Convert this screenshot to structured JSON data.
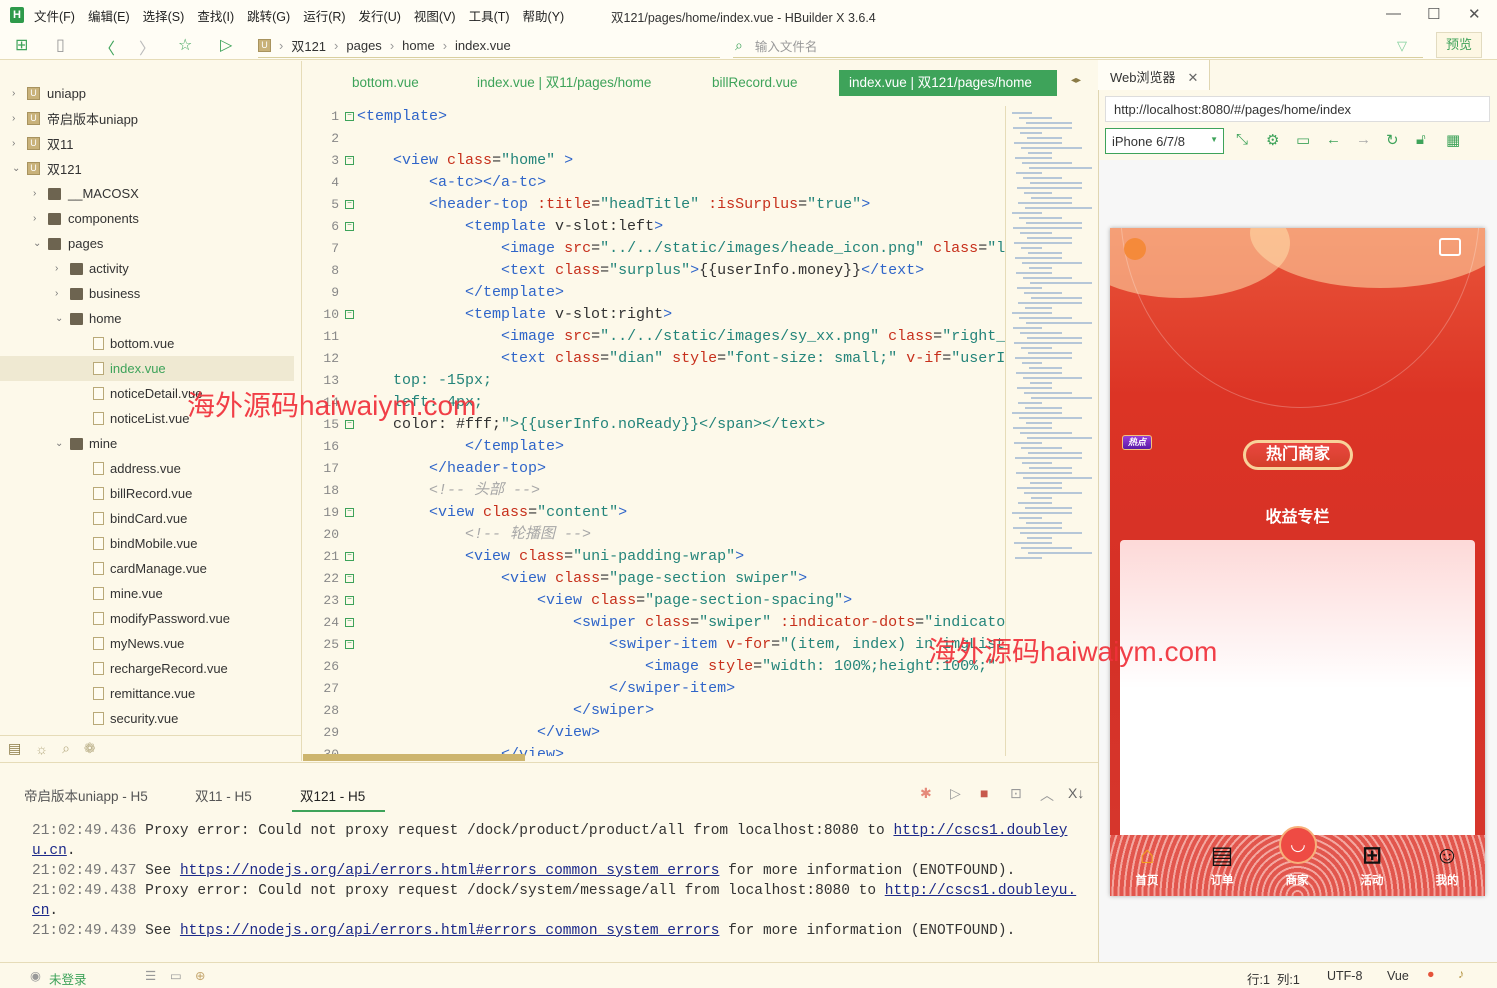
{
  "titlebar": {
    "menus": [
      "文件(F)",
      "编辑(E)",
      "选择(S)",
      "查找(I)",
      "跳转(G)",
      "运行(R)",
      "发行(U)",
      "视图(V)",
      "工具(T)",
      "帮助(Y)"
    ],
    "title": "双121/pages/home/index.vue - HBuilder X 3.6.4"
  },
  "toolbar": {
    "breadcrumb": [
      "双121",
      "pages",
      "home",
      "index.vue"
    ],
    "search_placeholder": "输入文件名",
    "preview": "预览"
  },
  "sidebar": {
    "items": [
      {
        "label": "uniapp",
        "level": 0,
        "type": "project",
        "expanded": false
      },
      {
        "label": "帝启版本uniapp",
        "level": 0,
        "type": "project",
        "expanded": false
      },
      {
        "label": "双11",
        "level": 0,
        "type": "project",
        "expanded": false
      },
      {
        "label": "双121",
        "level": 0,
        "type": "project",
        "expanded": true
      },
      {
        "label": "__MACOSX",
        "level": 1,
        "type": "folder",
        "expanded": false
      },
      {
        "label": "components",
        "level": 1,
        "type": "folder",
        "expanded": false
      },
      {
        "label": "pages",
        "level": 1,
        "type": "folder",
        "expanded": true
      },
      {
        "label": "activity",
        "level": 2,
        "type": "folder",
        "expanded": false
      },
      {
        "label": "business",
        "level": 2,
        "type": "folder",
        "expanded": false
      },
      {
        "label": "home",
        "level": 2,
        "type": "folder",
        "expanded": true
      },
      {
        "label": "bottom.vue",
        "level": 3,
        "type": "file"
      },
      {
        "label": "index.vue",
        "level": 3,
        "type": "file",
        "selected": true
      },
      {
        "label": "noticeDetail.vue",
        "level": 3,
        "type": "file"
      },
      {
        "label": "noticeList.vue",
        "level": 3,
        "type": "file"
      },
      {
        "label": "mine",
        "level": 2,
        "type": "folder",
        "expanded": true
      },
      {
        "label": "address.vue",
        "level": 3,
        "type": "file"
      },
      {
        "label": "billRecord.vue",
        "level": 3,
        "type": "file"
      },
      {
        "label": "bindCard.vue",
        "level": 3,
        "type": "file"
      },
      {
        "label": "bindMobile.vue",
        "level": 3,
        "type": "file"
      },
      {
        "label": "cardManage.vue",
        "level": 3,
        "type": "file"
      },
      {
        "label": "mine.vue",
        "level": 3,
        "type": "file"
      },
      {
        "label": "modifyPassword.vue",
        "level": 3,
        "type": "file"
      },
      {
        "label": "myNews.vue",
        "level": 3,
        "type": "file"
      },
      {
        "label": "rechargeRecord.vue",
        "level": 3,
        "type": "file"
      },
      {
        "label": "remittance.vue",
        "level": 3,
        "type": "file"
      },
      {
        "label": "security.vue",
        "level": 3,
        "type": "file"
      }
    ]
  },
  "editor": {
    "tabs": [
      "bottom.vue",
      "index.vue | 双11/pages/home",
      "billRecord.vue",
      "index.vue | 双121/pages/home"
    ],
    "active_tab": 3,
    "lines": [
      "<template>",
      "",
      "    <view class=\"home\" >",
      "        <a-tc></a-tc>",
      "        <header-top :title=\"headTitle\" :isSurplus=\"true\">",
      "            <template v-slot:left>",
      "                <image src=\"../../static/images/heade_icon.png\" class=\"l",
      "                <text class=\"surplus\">{{userInfo.money}}</text>",
      "            </template>",
      "            <template v-slot:right>",
      "                <image src=\"../../static/images/sy_xx.png\" class=\"right_",
      "                <text class=\"dian\" style=\"font-size: small;\" v-if=\"userI",
      "    top: -15px;",
      "    left: 4px;",
      "    color: #fff;\">{{userInfo.noReady}}</span></text>",
      "            </template>",
      "        </header-top>",
      "        <!-- 头部 -->",
      "        <view class=\"content\">",
      "            <!-- 轮播图 -->",
      "            <view class=\"uni-padding-wrap\">",
      "                <view class=\"page-section swiper\">",
      "                    <view class=\"page-section-spacing\">",
      "                        <swiper class=\"swiper\" :indicator-dots=\"indicato",
      "                            <swiper-item v-for=\"(item, index) in imgList",
      "                                <image style=\"width: 100%;height:100%;\"",
      "                            </swiper-item>",
      "                        </swiper>",
      "                    </view>",
      "                </view>"
    ],
    "foldable_lines": [
      1,
      3,
      5,
      6,
      10,
      15,
      19,
      21,
      22,
      23,
      24,
      25
    ]
  },
  "browser": {
    "tab": "Web浏览器",
    "url": "http://localhost:8080/#/pages/home/index",
    "device": "iPhone 6/7/8",
    "app": {
      "hot_badge": "热点",
      "hot_button": "热门商家",
      "section_title": "收益专栏",
      "tabbar": [
        "首页",
        "订单",
        "商家",
        "活动",
        "我的"
      ]
    }
  },
  "console": {
    "tabs": [
      "帝启版本uniapp - H5",
      "双11 - H5",
      "双121 - H5"
    ],
    "active_tab": 2,
    "logs": [
      {
        "time": "21:02:49.436",
        "text": "Proxy error: Could not proxy request /dock/product/product/all from localhost:8080 to ",
        "link": "http://cscs1.doubleyu.cn",
        "tail": "."
      },
      {
        "time": "21:02:49.437",
        "text": "See ",
        "link": "https://nodejs.org/api/errors.html#errors_common_system_errors",
        "tail": " for more information (ENOTFOUND)."
      },
      {
        "time": "21:02:49.438",
        "text": "Proxy error: Could not proxy request /dock/system/message/all from localhost:8080 to ",
        "link": "http://cscs1.doubleyu.cn",
        "tail": "."
      },
      {
        "time": "21:02:49.439",
        "text": "See ",
        "link": "https://nodejs.org/api/errors.html#errors_common_system_errors",
        "tail": " for more information (ENOTFOUND)."
      }
    ]
  },
  "status": {
    "login": "未登录",
    "cursor": "行:1  列:1",
    "encoding": "UTF-8",
    "language": "Vue"
  },
  "watermark": "海外源码haiwaiym.com",
  "colors": {
    "accent": "#3ea35a",
    "background": "#fdf9ea",
    "phone_red": "#d53026"
  }
}
